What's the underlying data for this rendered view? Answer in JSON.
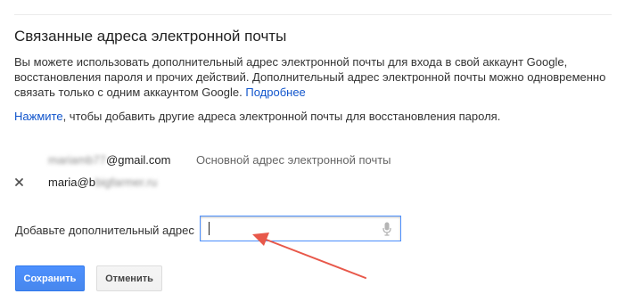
{
  "section": {
    "title": "Связанные адреса электронной почты",
    "description": "Вы можете использовать дополнительный адрес электронной почты для входа в свой аккаунт Google, восстановления пароля и прочих действий. Дополнительный адрес электронной почты можно одновременно связать только с одним аккаунтом Google.",
    "learn_more_link": "Подробнее",
    "hint_link": "Нажмите",
    "hint_text": ", чтобы добавить другие адреса электронной почты для восстановления пароля."
  },
  "emails": {
    "primary": {
      "blurred_part": "mariamb77",
      "visible_part": "@gmail.com",
      "badge": "Основной адрес электронной почты"
    },
    "secondary": {
      "visible_part": "maria@b",
      "blurred_part": "bigfarmer.ru"
    }
  },
  "add_form": {
    "label": "Добавьте дополнительный адрес",
    "input_value": "",
    "mic_icon": "microphone-icon"
  },
  "buttons": {
    "save": "Сохранить",
    "cancel": "Отменить"
  },
  "colors": {
    "link": "#1155cc",
    "primary_button": "#4d90fe",
    "annotation_arrow": "#e8584a"
  }
}
